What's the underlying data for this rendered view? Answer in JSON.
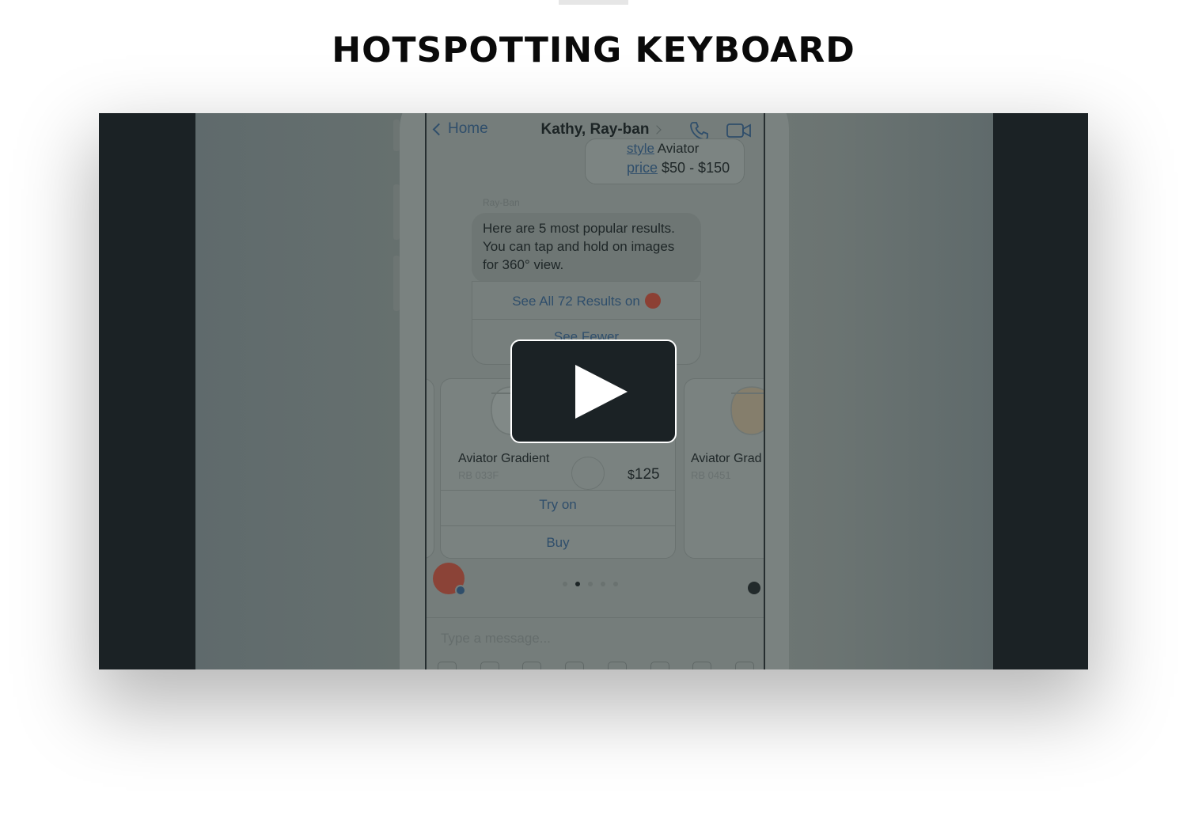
{
  "page": {
    "title": "HOTSPOTTING KEYBOARD"
  },
  "video": {
    "nav": {
      "back_label": "Home",
      "title": "Kathy, Ray-ban"
    },
    "top_bubble": {
      "style_link": "style",
      "style_value": "Aviator",
      "price_link": "price",
      "price_value": "$50 - $150"
    },
    "sender": "Ray-Ban",
    "bot_message": "Here are 5 most popular results. You can tap and hold on images for 360° view.",
    "see_all_label": "See All 72 Results on",
    "see_fewer_label": "See Fewer",
    "products": [
      {
        "name": "Aviator Gradient",
        "sku": "RB 033F",
        "currency": "$",
        "price": "125",
        "try_on_label": "Try on",
        "buy_label": "Buy"
      },
      {
        "name": "Aviator Grad",
        "sku": "RB 0451"
      }
    ],
    "compose_placeholder": "Type a message...",
    "toolbar_icons": [
      "text-format-icon",
      "camera-icon",
      "gallery-icon",
      "emoji-icon",
      "gif-icon",
      "mic-icon",
      "card-icon",
      "like-icon"
    ],
    "play_icon": "play-icon"
  }
}
